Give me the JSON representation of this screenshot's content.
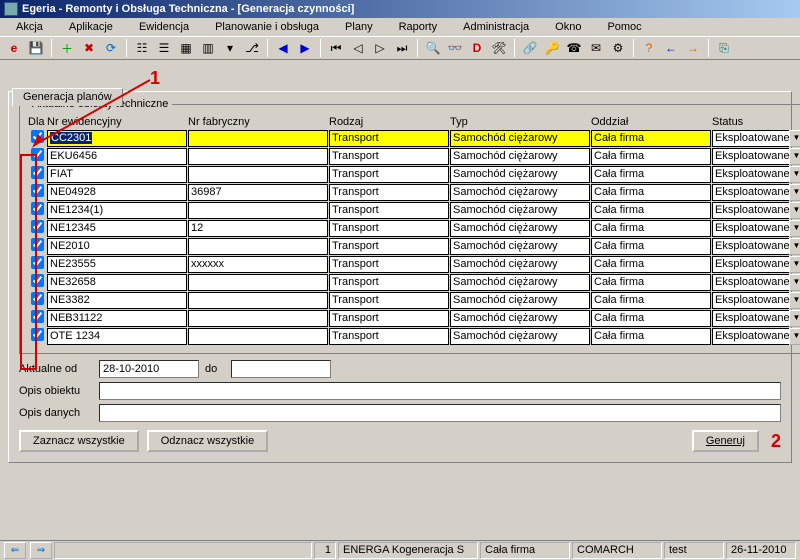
{
  "title": "Egeria - Remonty i Obsługa Techniczna - [Generacja czynności]",
  "menu": [
    "Akcja",
    "Aplikacje",
    "Ewidencja",
    "Planowanie i obsługa",
    "Plany",
    "Raporty",
    "Administracja",
    "Okno",
    "Pomoc"
  ],
  "tab_label": "Generacja planów",
  "group_legend": "Aktualne obiekty techniczne",
  "columns": {
    "dla": "Dla",
    "nr_ewid": "Nr ewidencyjny",
    "nr_fabr": "Nr fabryczny",
    "rodzaj": "Rodzaj",
    "typ": "Typ",
    "oddzial": "Oddział",
    "status": "Status"
  },
  "rows": [
    {
      "chk": true,
      "nr_ewid": "CC2301",
      "nr_fabr": "",
      "rodzaj": "Transport",
      "typ": "Samochód ciężarowy",
      "oddzial": "Cała firma",
      "status": "Eksploatowane",
      "sel": true
    },
    {
      "chk": true,
      "nr_ewid": "EKU6456",
      "nr_fabr": "",
      "rodzaj": "Transport",
      "typ": "Samochód ciężarowy",
      "oddzial": "Cała firma",
      "status": "Eksploatowane"
    },
    {
      "chk": true,
      "nr_ewid": "FIAT",
      "nr_fabr": "",
      "rodzaj": "Transport",
      "typ": "Samochód ciężarowy",
      "oddzial": "Cała firma",
      "status": "Eksploatowane"
    },
    {
      "chk": true,
      "nr_ewid": "NE04928",
      "nr_fabr": "36987",
      "rodzaj": "Transport",
      "typ": "Samochód ciężarowy",
      "oddzial": "Cała firma",
      "status": "Eksploatowane"
    },
    {
      "chk": true,
      "nr_ewid": "NE1234(1)",
      "nr_fabr": "",
      "rodzaj": "Transport",
      "typ": "Samochód ciężarowy",
      "oddzial": "Cała firma",
      "status": "Eksploatowane"
    },
    {
      "chk": true,
      "nr_ewid": "NE12345",
      "nr_fabr": "12",
      "rodzaj": "Transport",
      "typ": "Samochód ciężarowy",
      "oddzial": "Cała firma",
      "status": "Eksploatowane"
    },
    {
      "chk": true,
      "nr_ewid": "NE2010",
      "nr_fabr": "",
      "rodzaj": "Transport",
      "typ": "Samochód ciężarowy",
      "oddzial": "Cała firma",
      "status": "Eksploatowane"
    },
    {
      "chk": true,
      "nr_ewid": "NE23555",
      "nr_fabr": "xxxxxx",
      "rodzaj": "Transport",
      "typ": "Samochód ciężarowy",
      "oddzial": "Cała firma",
      "status": "Eksploatowane"
    },
    {
      "chk": true,
      "nr_ewid": "NE32658",
      "nr_fabr": "",
      "rodzaj": "Transport",
      "typ": "Samochód ciężarowy",
      "oddzial": "Cała firma",
      "status": "Eksploatowane"
    },
    {
      "chk": true,
      "nr_ewid": "NE3382",
      "nr_fabr": "",
      "rodzaj": "Transport",
      "typ": "Samochód ciężarowy",
      "oddzial": "Cała firma",
      "status": "Eksploatowane"
    },
    {
      "chk": true,
      "nr_ewid": "NEB31122",
      "nr_fabr": "",
      "rodzaj": "Transport",
      "typ": "Samochód ciężarowy",
      "oddzial": "Cała firma",
      "status": "Eksploatowane"
    },
    {
      "chk": true,
      "nr_ewid": "OTE 1234",
      "nr_fabr": "",
      "rodzaj": "Transport",
      "typ": "Samochód ciężarowy",
      "oddzial": "Cała firma",
      "status": "Eksploatowane"
    }
  ],
  "date_from_label": "Aktualne od",
  "date_from_value": "28-10-2010",
  "date_to_label": "do",
  "date_to_value": "",
  "opis_obiektu_label": "Opis obiektu",
  "opis_obiektu_value": "",
  "opis_danych_label": "Opis danych",
  "opis_danych_value": "",
  "btn_select_all": "Zaznacz wszystkie",
  "btn_deselect_all": "Odznacz wszystkie",
  "btn_generate": "Generuj",
  "annotations": {
    "a1": "1",
    "a2": "2"
  },
  "statusbar": {
    "count": "1",
    "company": "ENERGA Kogeneracja S",
    "oddzial": "Cała firma",
    "org": "COMARCH",
    "user": "test",
    "date": "26-11-2010"
  }
}
